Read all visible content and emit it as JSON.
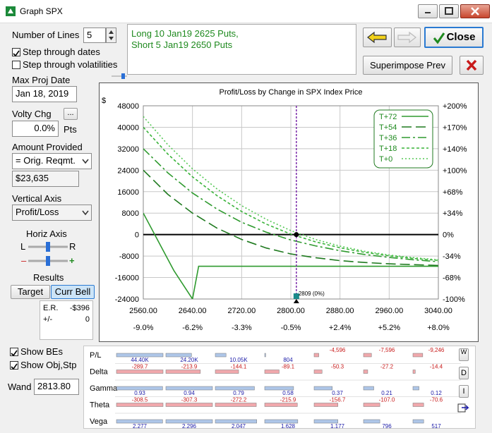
{
  "window": {
    "title": "Graph SPX"
  },
  "left": {
    "num_lines_label": "Number of Lines",
    "num_lines_value": "5",
    "step_dates_label": "Step through dates",
    "step_dates_checked": true,
    "step_vols_label": "Step through volatilities",
    "step_vols_checked": false,
    "max_proj_date_label": "Max Proj Date",
    "max_proj_date_value": "Jan 18, 2019",
    "volty_chg_label": "Volty Chg",
    "volty_btn_label": "...",
    "volty_value": "0.0%",
    "volty_unit": "Pts",
    "amount_label": "Amount Provided",
    "amount_select": "= Orig. Reqmt.",
    "amount_value": "$23,635",
    "vertical_axis_label": "Vertical Axis",
    "vertical_axis_select": "Profit/Loss",
    "horiz_axis_label": "Horiz Axis",
    "slider_left": "L",
    "slider_right": "R",
    "slider_minus": "–",
    "slider_plus": "+",
    "results_label": "Results",
    "target_btn": "Target",
    "curr_bell_btn": "Curr Bell",
    "er_label": "E.R.",
    "er_value": "-$396",
    "pm_label": "+/-",
    "pm_value": "0",
    "show_bes_label": "Show BEs",
    "show_objstp_label": "Show Obj,Stp",
    "wand_label": "Wand",
    "wand_value": "2813.80"
  },
  "position": {
    "line1": "Long 10 Jan19 2625 Puts,",
    "line2": "Short 5 Jan19 2650 Puts"
  },
  "buttons": {
    "close": "Close",
    "superimpose": "Superimpose Prev"
  },
  "chart_data": {
    "type": "line",
    "title": "Profit/Loss by Change in SPX Index Price",
    "ylabel_left": "$",
    "x_ticks": [
      "2560.00",
      "2640.00",
      "2720.00",
      "2800.00",
      "2880.00",
      "2960.00",
      "3040.00"
    ],
    "x_ticks_pct": [
      "-9.0%",
      "-6.2%",
      "-3.3%",
      "-0.5%",
      "+2.4%",
      "+5.2%",
      "+8.0%"
    ],
    "y_ticks_left": [
      "48000",
      "40000",
      "32000",
      "24000",
      "16000",
      "8000",
      "0",
      "-8000",
      "-16000",
      "-24000"
    ],
    "y_ticks_right": [
      "+200%",
      "+170%",
      "+140%",
      "+100%",
      "+68%",
      "+34%",
      "0%",
      "-34%",
      "-68%",
      "-100%"
    ],
    "xlim": [
      2560,
      3040
    ],
    "ylim": [
      -24000,
      48000
    ],
    "marker_label": "2809 (0%)",
    "marker_x": 2809,
    "series": [
      {
        "name": "T+72",
        "color": "#2e9a2e",
        "dash": "",
        "x": [
          2560,
          2610,
          2640,
          2650,
          3040
        ],
        "y": [
          8000,
          -13500,
          -24000,
          -11800,
          -11800
        ]
      },
      {
        "name": "T+54",
        "color": "#1f7a1f",
        "dash": "14 6",
        "x": [
          2560,
          2600,
          2640,
          2680,
          2720,
          2760,
          2800,
          2840,
          2880,
          2920,
          2960,
          3000,
          3040
        ],
        "y": [
          24000,
          15000,
          8000,
          2400,
          -1800,
          -5000,
          -7200,
          -8600,
          -9700,
          -10400,
          -10900,
          -11200,
          -11500
        ]
      },
      {
        "name": "T+36",
        "color": "#2e9a2e",
        "dash": "12 4 3 4",
        "x": [
          2560,
          2600,
          2640,
          2680,
          2720,
          2760,
          2800,
          2840,
          2880,
          2920,
          2960,
          3000,
          3040
        ],
        "y": [
          32000,
          23000,
          15500,
          9500,
          4600,
          900,
          -2000,
          -4200,
          -6000,
          -7400,
          -8500,
          -9400,
          -10100
        ]
      },
      {
        "name": "T+18",
        "color": "#39b339",
        "dash": "4 3",
        "x": [
          2560,
          2600,
          2640,
          2680,
          2720,
          2760,
          2800,
          2840,
          2880,
          2920,
          2960,
          3000,
          3040
        ],
        "y": [
          40000,
          30000,
          21500,
          14500,
          8600,
          3900,
          200,
          -2700,
          -4900,
          -6600,
          -7900,
          -8900,
          -9600
        ]
      },
      {
        "name": "T+0",
        "color": "#55c855",
        "dash": "2 3",
        "x": [
          2560,
          2600,
          2640,
          2680,
          2720,
          2760,
          2800,
          2840,
          2880,
          2920,
          2960,
          3000,
          3040
        ],
        "y": [
          44000,
          33500,
          24500,
          17000,
          10800,
          5700,
          1500,
          -1800,
          -4300,
          -6200,
          -7600,
          -8600,
          -9400
        ]
      }
    ]
  },
  "greeks": {
    "wlabel": "W",
    "dlabel": "D",
    "ilabel": "I",
    "rows": [
      {
        "name": "P/L",
        "values": [
          "44.40K",
          "24.20K",
          "10.05K",
          "804",
          "-4,596",
          "-7,596",
          "-9,246"
        ],
        "neg": [
          false,
          false,
          false,
          false,
          true,
          true,
          true
        ],
        "mag": [
          1.0,
          0.55,
          0.23,
          0.02,
          0.1,
          0.17,
          0.21
        ]
      },
      {
        "name": "Delta",
        "values": [
          "-289.7",
          "-213.9",
          "-144.1",
          "-89.1",
          "-50.3",
          "-27.2",
          "-14.4"
        ],
        "neg": [
          true,
          true,
          true,
          true,
          true,
          true,
          true
        ],
        "mag": [
          1.0,
          0.74,
          0.5,
          0.31,
          0.17,
          0.09,
          0.05
        ]
      },
      {
        "name": "Gamma",
        "values": [
          "0.93",
          "0.94",
          "0.79",
          "0.58",
          "0.37",
          "0.21",
          "0.12"
        ],
        "neg": [
          false,
          false,
          false,
          false,
          false,
          false,
          false
        ],
        "mag": [
          0.99,
          1.0,
          0.84,
          0.62,
          0.39,
          0.22,
          0.13
        ]
      },
      {
        "name": "Theta",
        "values": [
          "-308.5",
          "-307.3",
          "-272.2",
          "-215.9",
          "-156.7",
          "-107.0",
          "-70.6"
        ],
        "neg": [
          true,
          true,
          true,
          true,
          true,
          true,
          true
        ],
        "mag": [
          1.0,
          1.0,
          0.88,
          0.7,
          0.51,
          0.35,
          0.23
        ]
      },
      {
        "name": "Vega",
        "values": [
          "2,277",
          "2,296",
          "2,047",
          "1,628",
          "1,177",
          "796",
          "517"
        ],
        "neg": [
          false,
          false,
          false,
          false,
          false,
          false,
          false
        ],
        "mag": [
          0.99,
          1.0,
          0.89,
          0.71,
          0.51,
          0.35,
          0.23
        ]
      }
    ]
  },
  "colors": {
    "pos_bar": "#aec6e8",
    "neg_bar": "#f0a8ac",
    "pos_text": "#1a1aa8",
    "neg_text": "#c81a1a",
    "cursor": "#7a2aa8"
  }
}
